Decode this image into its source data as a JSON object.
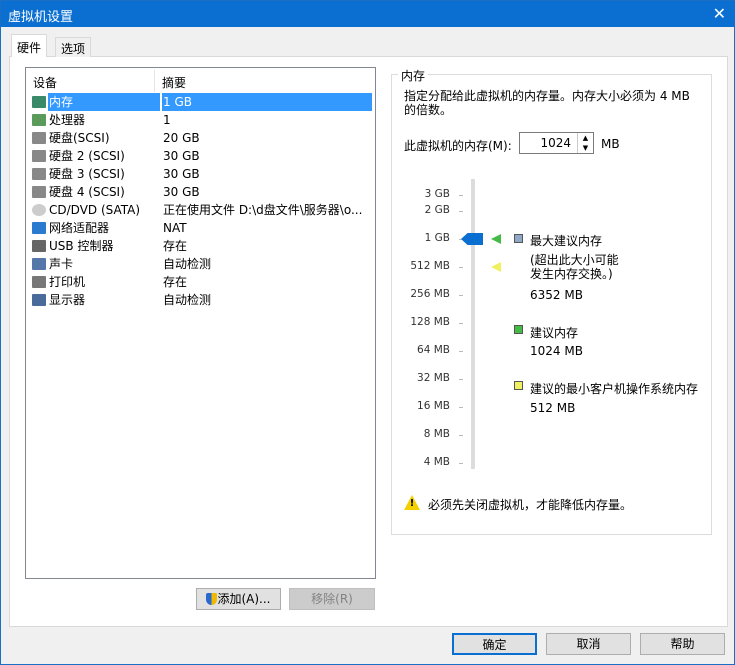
{
  "window": {
    "title": "虚拟机设置",
    "close": "✕"
  },
  "tabs": [
    {
      "label": "硬件"
    },
    {
      "label": "选项"
    }
  ],
  "device_list": {
    "headers": {
      "device": "设备",
      "summary": "摘要"
    },
    "rows": [
      {
        "name": "内存",
        "value": "1 GB",
        "icon": "memory-icon"
      },
      {
        "name": "处理器",
        "value": "1",
        "icon": "cpu-icon"
      },
      {
        "name": "硬盘(SCSI)",
        "value": "20 GB",
        "icon": "hard-disk-icon"
      },
      {
        "name": "硬盘 2 (SCSI)",
        "value": "30 GB",
        "icon": "hard-disk-icon"
      },
      {
        "name": "硬盘 3 (SCSI)",
        "value": "30 GB",
        "icon": "hard-disk-icon"
      },
      {
        "name": "硬盘 4 (SCSI)",
        "value": "30 GB",
        "icon": "hard-disk-icon"
      },
      {
        "name": "CD/DVD (SATA)",
        "value": "正在使用文件 D:\\d盘文件\\服务器\\o...",
        "icon": "cd-icon"
      },
      {
        "name": "网络适配器",
        "value": "NAT",
        "icon": "network-icon"
      },
      {
        "name": "USB 控制器",
        "value": "存在",
        "icon": "usb-icon"
      },
      {
        "name": "声卡",
        "value": "自动检测",
        "icon": "sound-icon"
      },
      {
        "name": "打印机",
        "value": "存在",
        "icon": "printer-icon"
      },
      {
        "name": "显示器",
        "value": "自动检测",
        "icon": "monitor-icon"
      }
    ]
  },
  "buttons": {
    "add": "添加(A)...",
    "remove": "移除(R)",
    "ok": "确定",
    "cancel": "取消",
    "help": "帮助"
  },
  "memory": {
    "group_title": "内存",
    "description": "指定分配给此虚拟机的内存量。内存大小必须为 4 MB 的倍数。",
    "field_label": "此虚拟机的内存(M):",
    "value": "1024",
    "unit": "MB",
    "scale": [
      "3 GB",
      "2 GB",
      "1 GB",
      "512 MB",
      "256 MB",
      "128 MB",
      "64 MB",
      "32 MB",
      "16 MB",
      "8 MB",
      "4 MB"
    ],
    "max_label": "最大建议内存",
    "max_note": "(超出此大小可能发生内存交换。)",
    "max_value": "6352 MB",
    "rec_label": "建议内存",
    "rec_value": "1024 MB",
    "min_label": "建议的最小客户机操作系统内存",
    "min_value": "512 MB",
    "warning": "必须先关闭虚拟机，才能降低内存量。",
    "colors": {
      "max": "#8fa8c8",
      "rec": "#44bb44",
      "min": "#f0f060",
      "thumb": "#0a6fd0"
    }
  }
}
